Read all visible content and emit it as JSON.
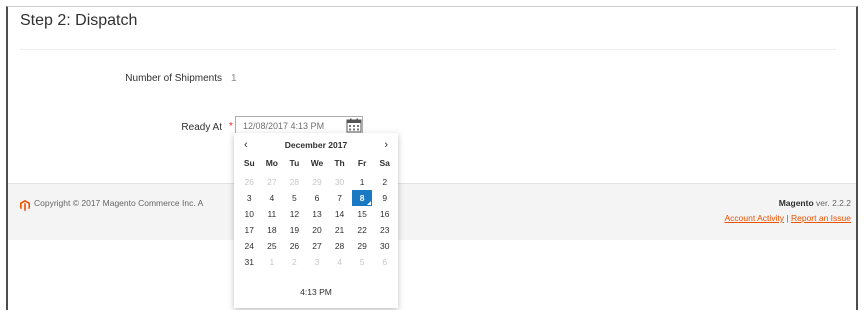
{
  "page": {
    "step_title": "Step 2: Dispatch"
  },
  "form": {
    "shipments_label": "Number of Shipments",
    "shipments_value": "1",
    "ready_label": "Ready At",
    "required_marker": "*",
    "ready_value": "12/08/2017 4:13 PM",
    "calendar_icon": "calendar-icon"
  },
  "datepicker": {
    "prev": "‹",
    "next": "›",
    "month_year": "December 2017",
    "weekdays": [
      "Su",
      "Mo",
      "Tu",
      "We",
      "Th",
      "Fr",
      "Sa"
    ],
    "weeks": [
      [
        "26",
        "27",
        "28",
        "29",
        "30",
        "1",
        "2"
      ],
      [
        "3",
        "4",
        "5",
        "6",
        "7",
        "8",
        "9"
      ],
      [
        "10",
        "11",
        "12",
        "13",
        "14",
        "15",
        "16"
      ],
      [
        "17",
        "18",
        "19",
        "20",
        "21",
        "22",
        "23"
      ],
      [
        "24",
        "25",
        "26",
        "27",
        "28",
        "29",
        "30"
      ],
      [
        "31",
        "1",
        "2",
        "3",
        "4",
        "5",
        "6"
      ]
    ],
    "muted": [
      [
        0,
        0
      ],
      [
        0,
        1
      ],
      [
        0,
        2
      ],
      [
        0,
        3
      ],
      [
        0,
        4
      ],
      [
        5,
        1
      ],
      [
        5,
        2
      ],
      [
        5,
        3
      ],
      [
        5,
        4
      ],
      [
        5,
        5
      ],
      [
        5,
        6
      ]
    ],
    "selected_day": "8",
    "time": "4:13 PM",
    "selected_color": "#1979c3"
  },
  "footer": {
    "copyright": "Copyright © 2017 Magento Commerce Inc. A",
    "product": "Magento",
    "version": "ver. 2.2.2",
    "account_activity": "Account Activity",
    "separator": "|",
    "report_issue": "Report an Issue",
    "link_color": "#eb5202",
    "logo_icon": "magento-logo-icon"
  }
}
